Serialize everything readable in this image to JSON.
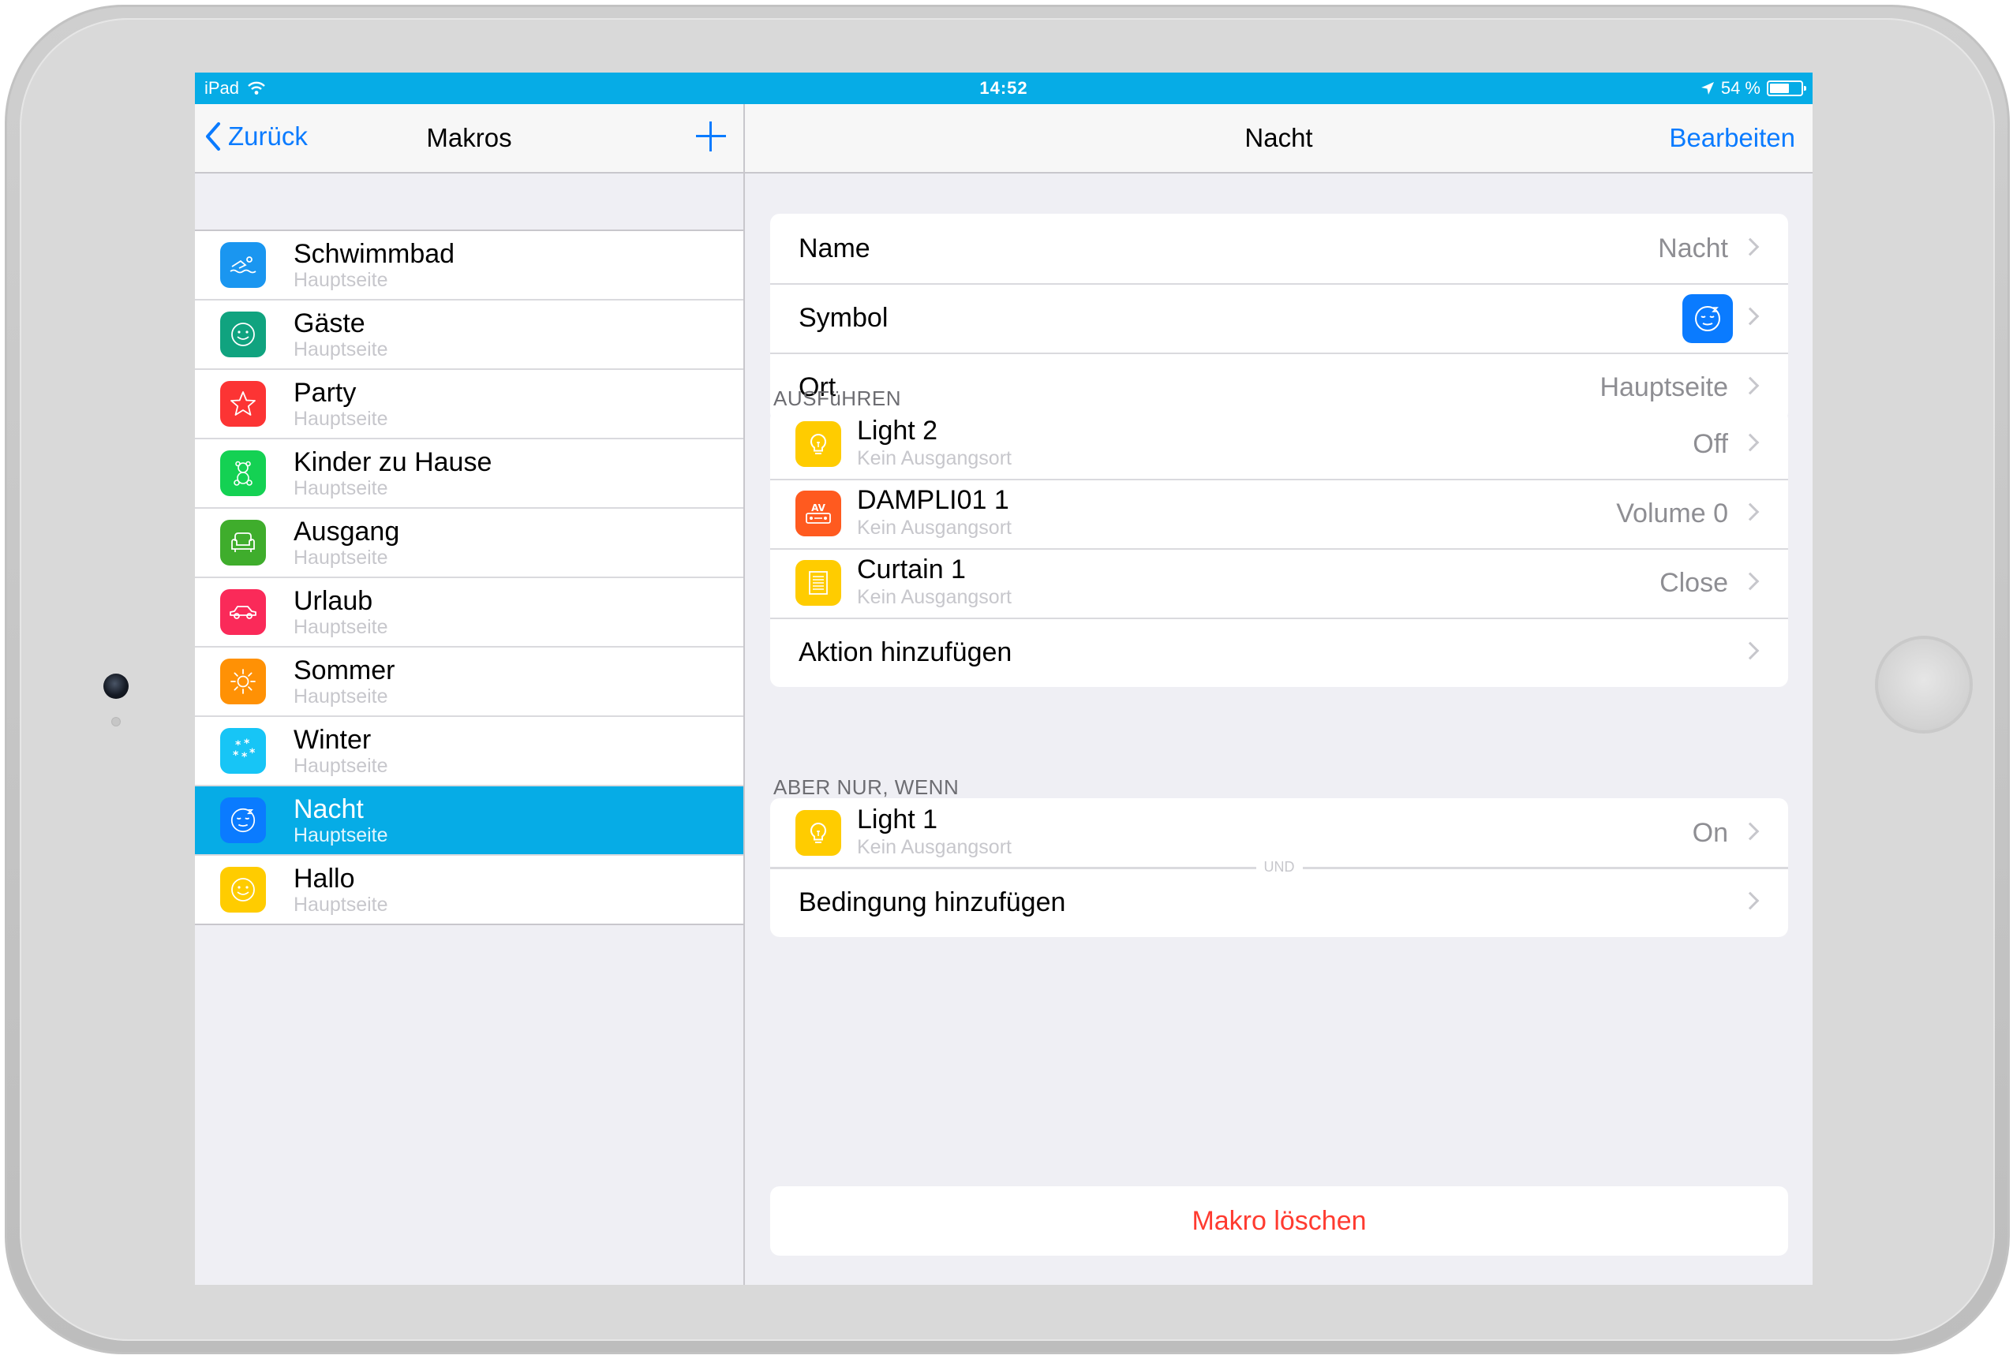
{
  "colors": {
    "status_bar": "#06ace6",
    "accent_blue": "#0a7bff",
    "selected_row": "#06ace6",
    "destructive_red": "#ff3b30"
  },
  "status_bar": {
    "device": "iPad",
    "time": "14:52",
    "battery": "54 %",
    "battery_level": 0.54
  },
  "master": {
    "back_label": "Zurück",
    "title": "Makros",
    "items": [
      {
        "name": "Schwimmbad",
        "subtitle": "Hauptseite",
        "icon": "swimmer-icon",
        "color": "#1a96f0"
      },
      {
        "name": "Gäste",
        "subtitle": "Hauptseite",
        "icon": "smiley-icon",
        "color": "#10a37f"
      },
      {
        "name": "Party",
        "subtitle": "Hauptseite",
        "icon": "star-icon",
        "color": "#fc3434"
      },
      {
        "name": "Kinder zu Hause",
        "subtitle": "Hauptseite",
        "icon": "teddy-bear-icon",
        "color": "#14d153"
      },
      {
        "name": "Ausgang",
        "subtitle": "Hauptseite",
        "icon": "armchair-icon",
        "color": "#3fad2c"
      },
      {
        "name": "Urlaub",
        "subtitle": "Hauptseite",
        "icon": "car-icon",
        "color": "#fa2a59"
      },
      {
        "name": "Sommer",
        "subtitle": "Hauptseite",
        "icon": "sun-icon",
        "color": "#ff9105"
      },
      {
        "name": "Winter",
        "subtitle": "Hauptseite",
        "icon": "snowflake-icon",
        "color": "#17c5f6"
      },
      {
        "name": "Nacht",
        "subtitle": "Hauptseite",
        "icon": "sleeping-face-icon",
        "color": "#0a7bff",
        "selected": true
      },
      {
        "name": "Hallo",
        "subtitle": "Hauptseite",
        "icon": "smiley-icon",
        "color": "#ffcc00"
      }
    ]
  },
  "detail": {
    "title": "Nacht",
    "edit_label": "Bearbeiten",
    "properties": [
      {
        "label": "Name",
        "value": "Nacht"
      },
      {
        "label": "Symbol",
        "icon": "sleeping-face-icon"
      },
      {
        "label": "Ort",
        "value": "Hauptseite"
      }
    ],
    "execute_header": "AUSFüHREN",
    "actions": [
      {
        "title": "Light 2",
        "subtitle": "Kein Ausgangsort",
        "value": "Off",
        "icon": "light-bulb-icon",
        "color": "#ffcc00"
      },
      {
        "title": "DAMPLI01 1",
        "subtitle": "Kein Ausgangsort",
        "value": "Volume 0",
        "icon": "av-receiver-icon",
        "color": "#ff5a1f"
      },
      {
        "title": "Curtain 1",
        "subtitle": "Kein Ausgangsort",
        "value": "Close",
        "icon": "curtain-icon",
        "color": "#ffcc00"
      }
    ],
    "add_action_label": "Aktion hinzufügen",
    "condition_header": "ABER NUR, WENN",
    "conditions": [
      {
        "title": "Light 1",
        "subtitle": "Kein Ausgangsort",
        "value": "On",
        "icon": "light-bulb-icon",
        "color": "#ffcc00"
      }
    ],
    "conjunction_label": "UND",
    "add_condition_label": "Bedingung hinzufügen",
    "delete_label": "Makro löschen"
  }
}
